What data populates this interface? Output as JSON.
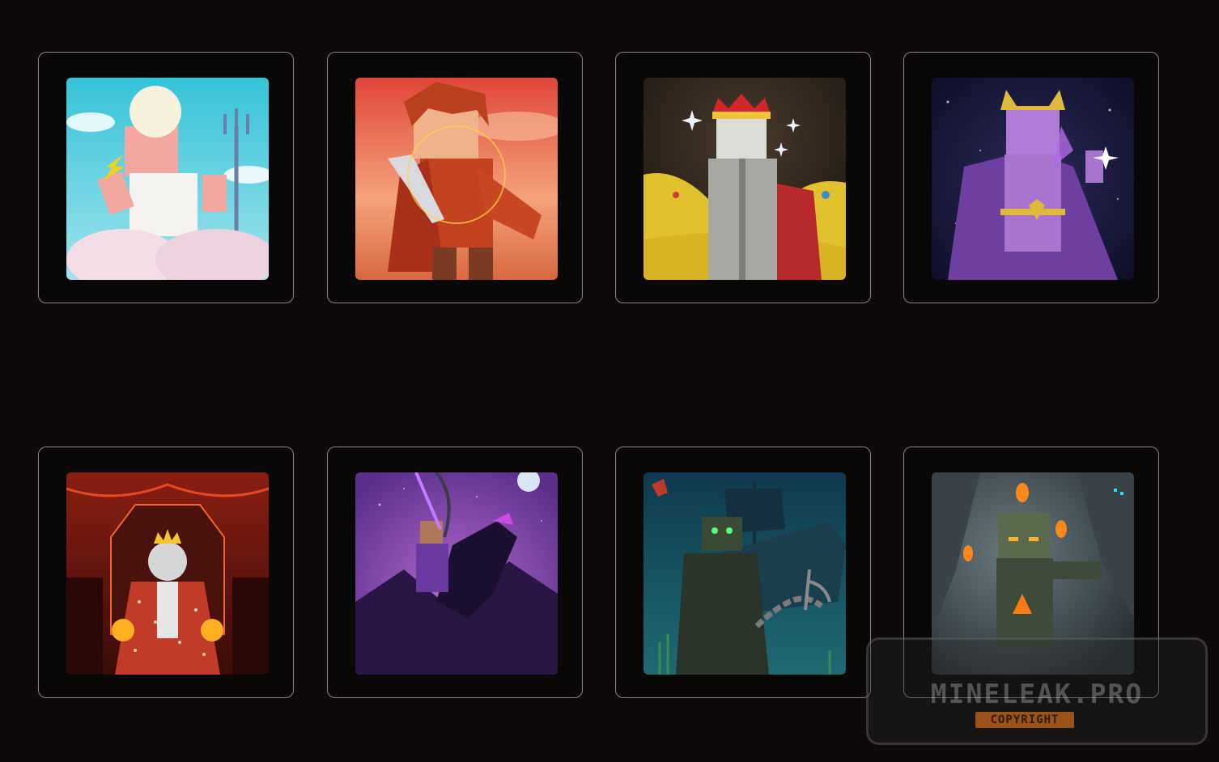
{
  "gallery": {
    "cards": [
      {
        "icon": "zeus-skin-icon"
      },
      {
        "icon": "warrior-skin-icon"
      },
      {
        "icon": "king-skin-icon"
      },
      {
        "icon": "cosmic-mage-skin-icon"
      },
      {
        "icon": "skeleton-king-skin-icon"
      },
      {
        "icon": "dragon-rider-skin-icon"
      },
      {
        "icon": "cthulhu-pirate-skin-icon"
      },
      {
        "icon": "ember-golem-skin-icon"
      }
    ]
  },
  "watermark": {
    "title": "MINELEAK.PRO",
    "badge": "COPYRIGHT"
  },
  "colors": {
    "background": "#0e0a0a",
    "card_border": "#8a8482",
    "badge": "#d66e1c"
  }
}
